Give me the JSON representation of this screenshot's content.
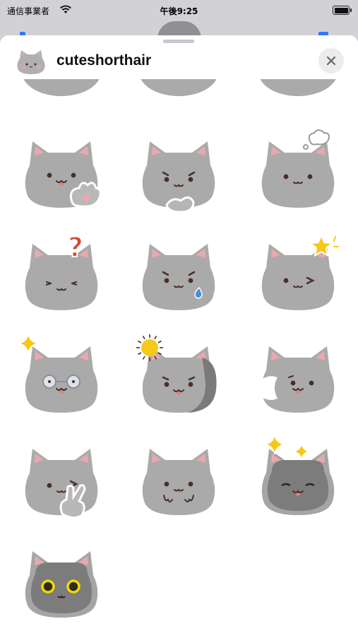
{
  "status_bar": {
    "carrier": "通信事業者",
    "time": "午後9:25"
  },
  "sheet": {
    "title": "cuteshorthair",
    "close_icon": "close-icon"
  },
  "stickers": [
    {
      "name": "sticker-partial-1",
      "variant": "partial"
    },
    {
      "name": "sticker-partial-2",
      "variant": "partial-blush"
    },
    {
      "name": "sticker-partial-3",
      "variant": "partial"
    },
    {
      "name": "sticker-paw-wave",
      "variant": "paw"
    },
    {
      "name": "sticker-thinking-mouth",
      "variant": "think"
    },
    {
      "name": "sticker-thought-bubble",
      "variant": "thought"
    },
    {
      "name": "sticker-question",
      "variant": "question"
    },
    {
      "name": "sticker-sweat",
      "variant": "sweat"
    },
    {
      "name": "sticker-star-wink",
      "variant": "starwink"
    },
    {
      "name": "sticker-glasses",
      "variant": "glasses"
    },
    {
      "name": "sticker-shock",
      "variant": "shock"
    },
    {
      "name": "sticker-surprised",
      "variant": "surprise"
    },
    {
      "name": "sticker-peace-wink",
      "variant": "peace"
    },
    {
      "name": "sticker-shy",
      "variant": "shy"
    },
    {
      "name": "sticker-dark-sparkle",
      "variant": "dark"
    },
    {
      "name": "sticker-dark-yellow-eyes",
      "variant": "darkeyes"
    }
  ],
  "colors": {
    "fur": "#aaaaaa",
    "ear_inner": "#e9a8b0",
    "dark_fur": "#7c7c7c",
    "star": "#f5c918",
    "question": "#d14b2b",
    "tear": "#4a8fd6",
    "accent": "#3478f6"
  }
}
